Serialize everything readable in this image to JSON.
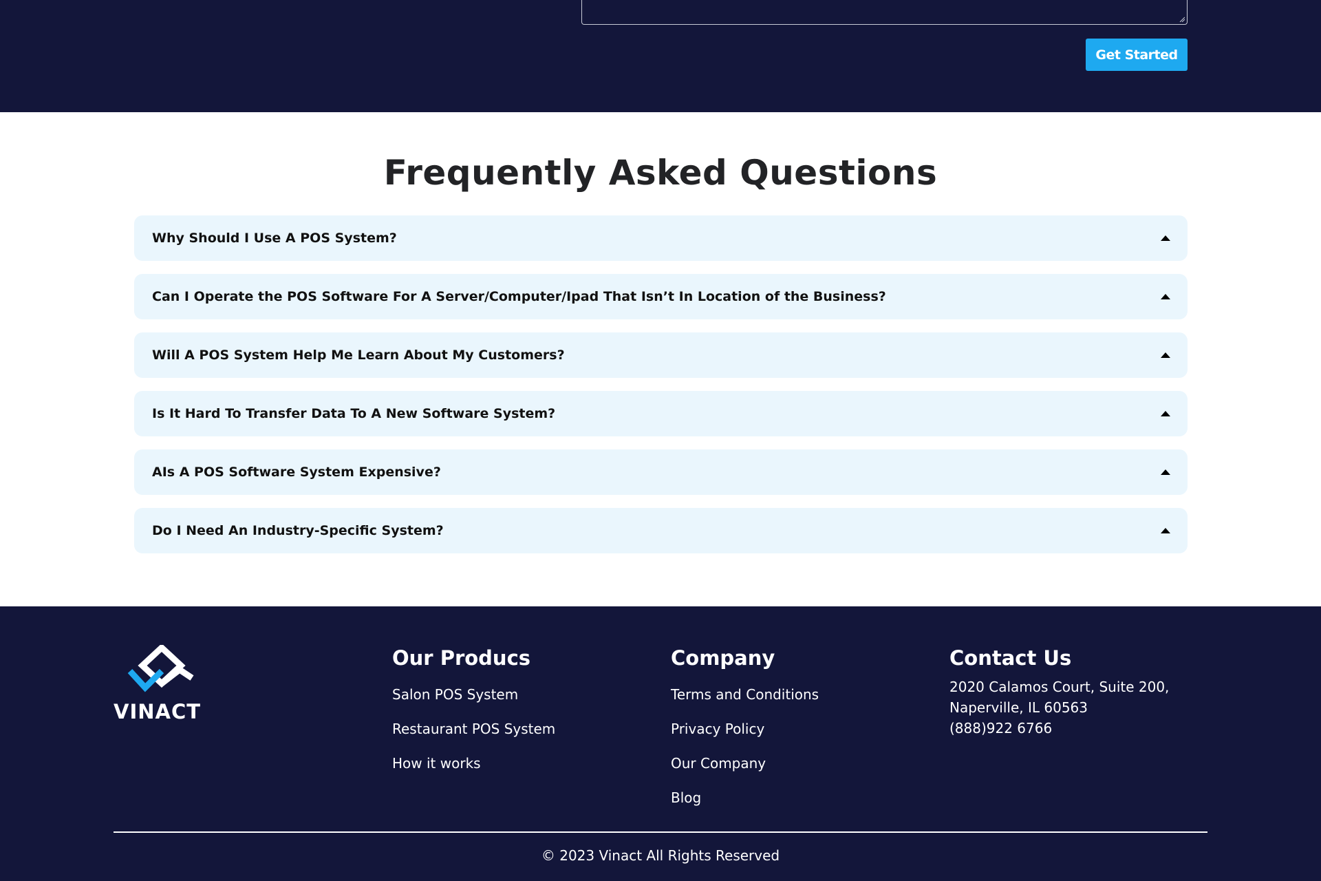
{
  "contact_form": {
    "submit_label": "Get Started",
    "accent_color": "#1ea9f0"
  },
  "faq": {
    "title": "Frequently Asked Questions",
    "items": [
      {
        "question": "Why Should I Use A POS System?"
      },
      {
        "question": "Can I Operate the POS Software For A Server/Computer/Ipad That Isn’t In Location of the Business?"
      },
      {
        "question": "Will A POS System Help Me Learn About My Customers?"
      },
      {
        "question": "Is It Hard To Transfer Data To A New Software System?"
      },
      {
        "question": "AIs A POS Software System Expensive?"
      },
      {
        "question": "Do I Need An Industry-Specific System?"
      }
    ]
  },
  "footer": {
    "logo_text": "VINACT",
    "products": {
      "heading": "Our Producs",
      "links": [
        "Salon POS System",
        "Restaurant POS System",
        "How it works"
      ]
    },
    "company": {
      "heading": "Company",
      "links": [
        "Terms and Conditions",
        "Privacy Policy",
        "Our Company",
        "Blog"
      ]
    },
    "contact": {
      "heading": "Contact Us",
      "address_line1": "2020 Calamos Court, Suite 200,",
      "address_line2": "Naperville, IL 60563",
      "phone": "(888)922 6766"
    },
    "copyright": "© 2023 Vinact All Rights Reserved"
  },
  "colors": {
    "dark_navy": "#13163a",
    "faq_item_bg": "#eaf6fd",
    "logo_blue": "#1ea9f0"
  }
}
